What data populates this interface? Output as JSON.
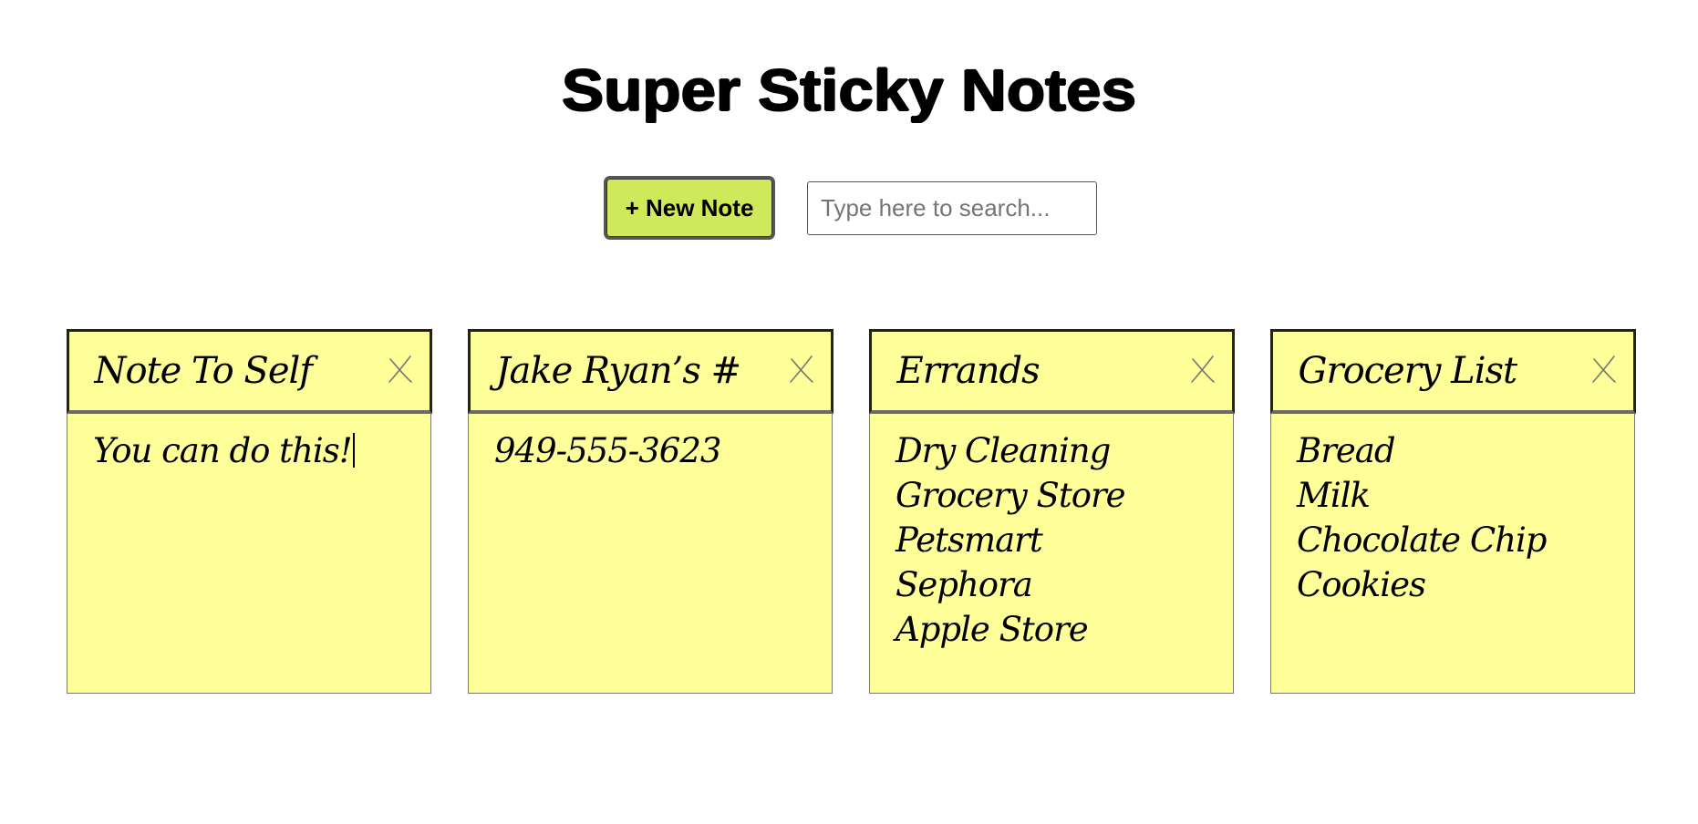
{
  "app": {
    "title": "Super Sticky Notes"
  },
  "toolbar": {
    "new_note_label": "+ New Note",
    "search_placeholder": "Type here to search...",
    "search_value": ""
  },
  "colors": {
    "note_background": "#ffff99",
    "new_note_button": "#cfe95a"
  },
  "icons": {
    "close": "close-icon"
  },
  "notes": [
    {
      "title": "Note To Self",
      "lines": [
        "You can do this!"
      ]
    },
    {
      "title": "Jake Ryan’s #",
      "lines": [
        "949-555-3623"
      ]
    },
    {
      "title": "Errands",
      "lines": [
        "Dry Cleaning",
        "Grocery Store",
        "Petsmart",
        "Sephora",
        "Apple Store"
      ]
    },
    {
      "title": "Grocery List",
      "lines": [
        "Bread",
        "Milk",
        "Chocolate Chip",
        "Cookies"
      ]
    }
  ]
}
